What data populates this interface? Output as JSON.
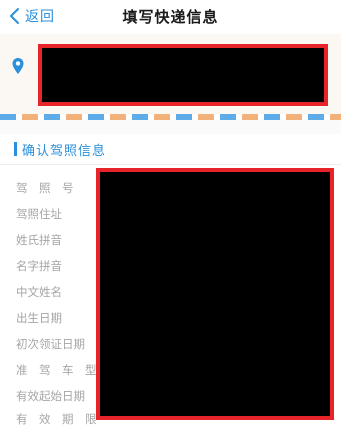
{
  "navbar": {
    "back_label": "返回",
    "title": "填写快递信息"
  },
  "address": {
    "value": ""
  },
  "section": {
    "title": "确认驾照信息"
  },
  "fields": [
    {
      "label": "驾　照　号",
      "value": ""
    },
    {
      "label": "驾照住址",
      "value": ""
    },
    {
      "label": "姓氏拼音",
      "value": ""
    },
    {
      "label": "名字拼音",
      "value": ""
    },
    {
      "label": "中文姓名",
      "value": ""
    },
    {
      "label": "出生日期",
      "value": ""
    },
    {
      "label": "初次领证日期",
      "value": ""
    },
    {
      "label": "准　驾　车　型",
      "value": ""
    },
    {
      "label": "有效起始日期",
      "value": ""
    },
    {
      "label": "有　效　期　限",
      "value": ""
    }
  ],
  "colors": {
    "accent": "#2a8fdc",
    "redaction_border": "#e8242b",
    "label_gray": "#a5a5a5"
  },
  "icons": {
    "back": "chevron-left-icon",
    "location": "location-pin-icon"
  }
}
